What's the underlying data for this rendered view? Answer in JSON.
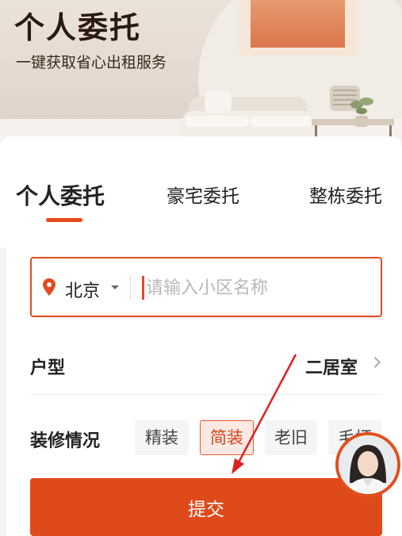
{
  "hero": {
    "title": "个人委托",
    "subtitle": "一键获取省心出租服务"
  },
  "tabs": [
    {
      "label": "个人委托",
      "active": true
    },
    {
      "label": "豪宅委托",
      "active": false
    },
    {
      "label": "整栋委托",
      "active": false
    }
  ],
  "search": {
    "city": "北京",
    "placeholder": "请输入小区名称",
    "value": ""
  },
  "layout_row": {
    "label": "户型",
    "value": "二居室"
  },
  "decoration": {
    "label": "装修情况",
    "options": [
      {
        "label": "精装",
        "selected": false
      },
      {
        "label": "简装",
        "selected": true
      },
      {
        "label": "老旧",
        "selected": false
      },
      {
        "label": "毛坯",
        "selected": false
      }
    ]
  },
  "submit_label": "提交",
  "colors": {
    "accent": "#df4a1c",
    "selected_bg": "#fde9e3",
    "text": "#222222"
  }
}
